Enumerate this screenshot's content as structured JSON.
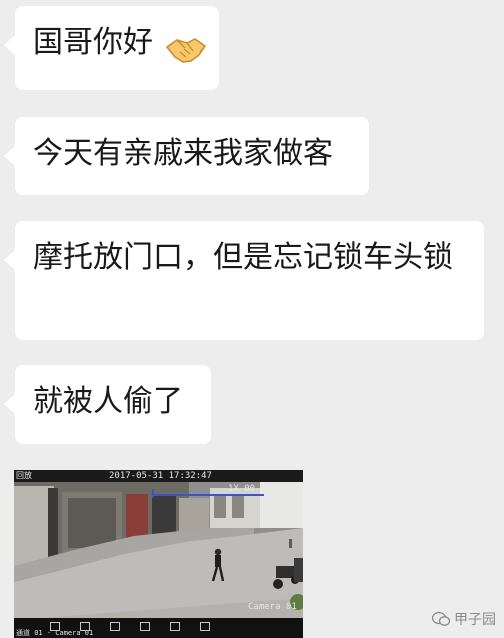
{
  "messages": [
    {
      "text": "国哥你好"
    },
    {
      "text": "今天有亲戚来我家做客"
    },
    {
      "text": "摩托放门口，但是忘记锁车头锁"
    },
    {
      "text": "就被人偷了"
    }
  ],
  "handshake_emoji": "handshake-icon",
  "video": {
    "timestamp": "2017-05-31 17:32:47",
    "playback_label": "回放",
    "camera_label": "Camera 01",
    "footer_label": "通道 01 · Camera 01",
    "zoom_text": "1X  00"
  },
  "watermark": {
    "text": "甲子园"
  },
  "colors": {
    "background": "#ededed",
    "bubble": "#ffffff",
    "text": "#191919"
  }
}
